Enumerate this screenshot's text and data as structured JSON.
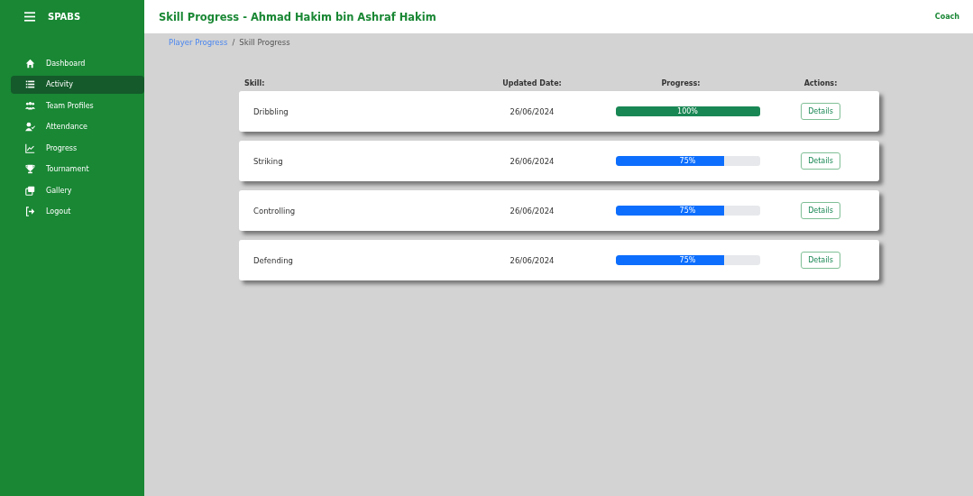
{
  "sidebar": {
    "brand": "SPABS",
    "items": [
      {
        "label": "Dashboard",
        "selected": false
      },
      {
        "label": "Activity",
        "selected": true
      },
      {
        "label": "Team Profiles",
        "selected": false
      },
      {
        "label": "Attendance",
        "selected": false
      },
      {
        "label": "Progress",
        "selected": false
      },
      {
        "label": "Tournament",
        "selected": false
      },
      {
        "label": "Gallery",
        "selected": false
      },
      {
        "label": "Logout",
        "selected": false
      }
    ]
  },
  "header": {
    "title": "Skill Progress - Ahmad Hakim bin Ashraf Hakim",
    "role": "Coach"
  },
  "breadcrumb": {
    "link": "Player Progress",
    "separator": "/",
    "current": "Skill Progress"
  },
  "table": {
    "columns": [
      "Skill:",
      "Updated Date:",
      "Progress:",
      "Actions:"
    ],
    "rows": [
      {
        "skill": "Dribbling",
        "date": "26/06/2024",
        "level": 1,
        "reading": "100%",
        "color": "#198754",
        "action": "Details"
      },
      {
        "skill": "Striking",
        "date": "26/06/2024",
        "level": 0.75,
        "reading": "75%",
        "color": "#0d6efd",
        "action": "Details"
      },
      {
        "skill": "Controlling",
        "date": "26/06/2024",
        "level": 0.75,
        "reading": "75%",
        "color": "#0d6efd",
        "action": "Details"
      },
      {
        "skill": "Defending",
        "date": "26/06/2024",
        "level": 0.75,
        "reading": "75%",
        "color": "#0d6efd",
        "action": "Details"
      }
    ]
  }
}
